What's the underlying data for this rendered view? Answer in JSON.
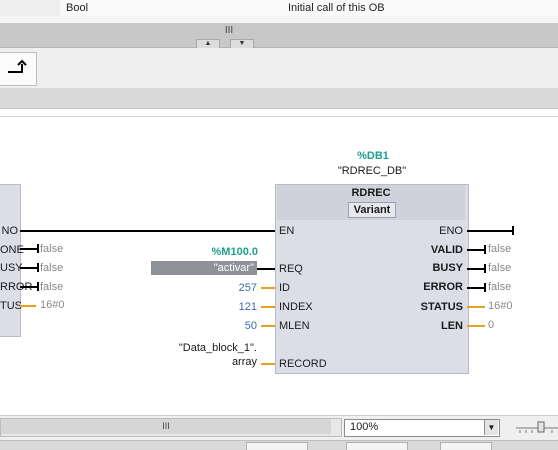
{
  "table": {
    "cells": [
      "",
      "Bool",
      "",
      "Initial call of this OB"
    ]
  },
  "splitter": {
    "grip": "III",
    "up": "▲",
    "down": "▼"
  },
  "network": {
    "instance_db_address": "%DB1",
    "instance_db_name": "\"RDREC_DB\"",
    "block_name": "RDREC",
    "block_type": "Variant",
    "m_address": "%M100.0",
    "m_symbol": "\"activar\"",
    "record_symbol_line1": "\"Data_block_1\".",
    "record_symbol_line2": "array",
    "left_block_pins": [
      "NO",
      "ONE",
      "USY",
      "RROR",
      "TUS"
    ],
    "left_block_values": [
      "false",
      "false",
      "false",
      "16#0"
    ],
    "inputs": [
      {
        "pin": "EN",
        "value": ""
      },
      {
        "pin": "REQ",
        "value": ""
      },
      {
        "pin": "ID",
        "value": "257"
      },
      {
        "pin": "INDEX",
        "value": "121"
      },
      {
        "pin": "MLEN",
        "value": "50"
      },
      {
        "pin": "RECORD",
        "value": ""
      }
    ],
    "outputs": [
      {
        "pin": "ENO",
        "value": ""
      },
      {
        "pin": "VALID",
        "value": "false"
      },
      {
        "pin": "BUSY",
        "value": "false"
      },
      {
        "pin": "ERROR",
        "value": "false"
      },
      {
        "pin": "STATUS",
        "value": "16#0"
      },
      {
        "pin": "LEN",
        "value": "0"
      }
    ]
  },
  "bottom": {
    "scroll_grip": "III",
    "zoom": "100%",
    "zoom_dropdown": "▼"
  },
  "colors": {
    "accent_teal": "#1f9f8f",
    "wire_orange": "#e8a01e",
    "block_fill": "#dcdee5"
  },
  "icons": [
    "branch-close-icon",
    "dropdown-arrow-icon",
    "zoom-slider-icon"
  ]
}
